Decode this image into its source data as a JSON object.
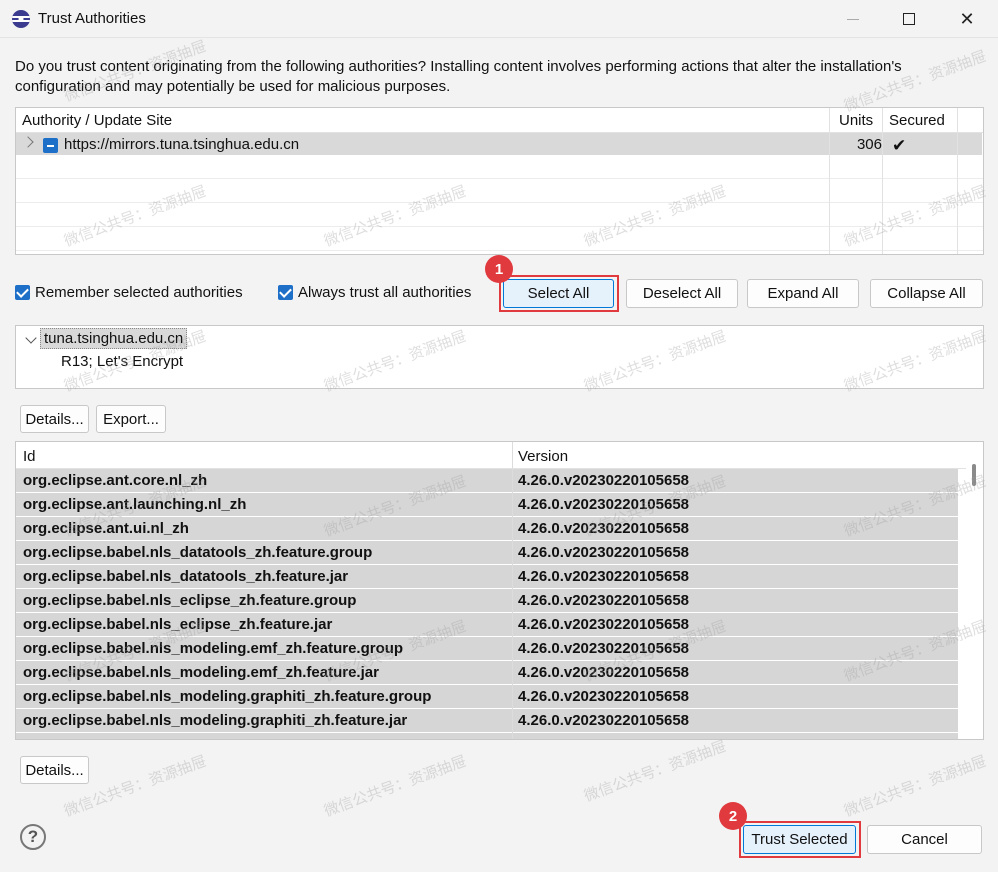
{
  "window": {
    "title": "Trust Authorities",
    "minimize_icon": "minimize-icon",
    "maximize_icon": "maximize-icon",
    "close_icon": "close-icon"
  },
  "description": "Do you trust content originating from the following authorities?  Installing content involves performing actions that alter the installation's configuration and may potentially be used for malicious purposes.",
  "authority_table": {
    "columns": [
      "Authority / Update Site",
      "Units",
      "Secured"
    ],
    "rows": [
      {
        "site": "https://mirrors.tuna.tsinghua.edu.cn",
        "units": "306",
        "secured": "✔"
      }
    ]
  },
  "options": {
    "remember_label": "Remember selected authorities",
    "always_trust_label": "Always trust all authorities"
  },
  "buttons": {
    "select_all": "Select All",
    "deselect_all": "Deselect All",
    "expand_all": "Expand All",
    "collapse_all": "Collapse All",
    "details": "Details...",
    "export": "Export...",
    "details2": "Details...",
    "trust_selected": "Trust Selected",
    "cancel": "Cancel"
  },
  "certificate_tree": {
    "node": "tuna.tsinghua.edu.cn",
    "child": "R13; Let's Encrypt"
  },
  "iu_table": {
    "columns": [
      "Id",
      "Version"
    ],
    "rows": [
      {
        "id": "org.eclipse.ant.core.nl_zh",
        "version": "4.26.0.v20230220105658"
      },
      {
        "id": "org.eclipse.ant.launching.nl_zh",
        "version": "4.26.0.v20230220105658"
      },
      {
        "id": "org.eclipse.ant.ui.nl_zh",
        "version": "4.26.0.v20230220105658"
      },
      {
        "id": "org.eclipse.babel.nls_datatools_zh.feature.group",
        "version": "4.26.0.v20230220105658"
      },
      {
        "id": "org.eclipse.babel.nls_datatools_zh.feature.jar",
        "version": "4.26.0.v20230220105658"
      },
      {
        "id": "org.eclipse.babel.nls_eclipse_zh.feature.group",
        "version": "4.26.0.v20230220105658"
      },
      {
        "id": "org.eclipse.babel.nls_eclipse_zh.feature.jar",
        "version": "4.26.0.v20230220105658"
      },
      {
        "id": "org.eclipse.babel.nls_modeling.emf_zh.feature.group",
        "version": "4.26.0.v20230220105658"
      },
      {
        "id": "org.eclipse.babel.nls_modeling.emf_zh.feature.jar",
        "version": "4.26.0.v20230220105658"
      },
      {
        "id": "org.eclipse.babel.nls_modeling.graphiti_zh.feature.group",
        "version": "4.26.0.v20230220105658"
      },
      {
        "id": "org.eclipse.babel.nls_modeling.graphiti_zh.feature.jar",
        "version": "4.26.0.v20230220105658"
      }
    ]
  },
  "annotations": {
    "step1": "1",
    "step2": "2",
    "color": "#e0393e"
  },
  "help_icon": "?",
  "watermark_text": "微信公共号：资源抽屉"
}
